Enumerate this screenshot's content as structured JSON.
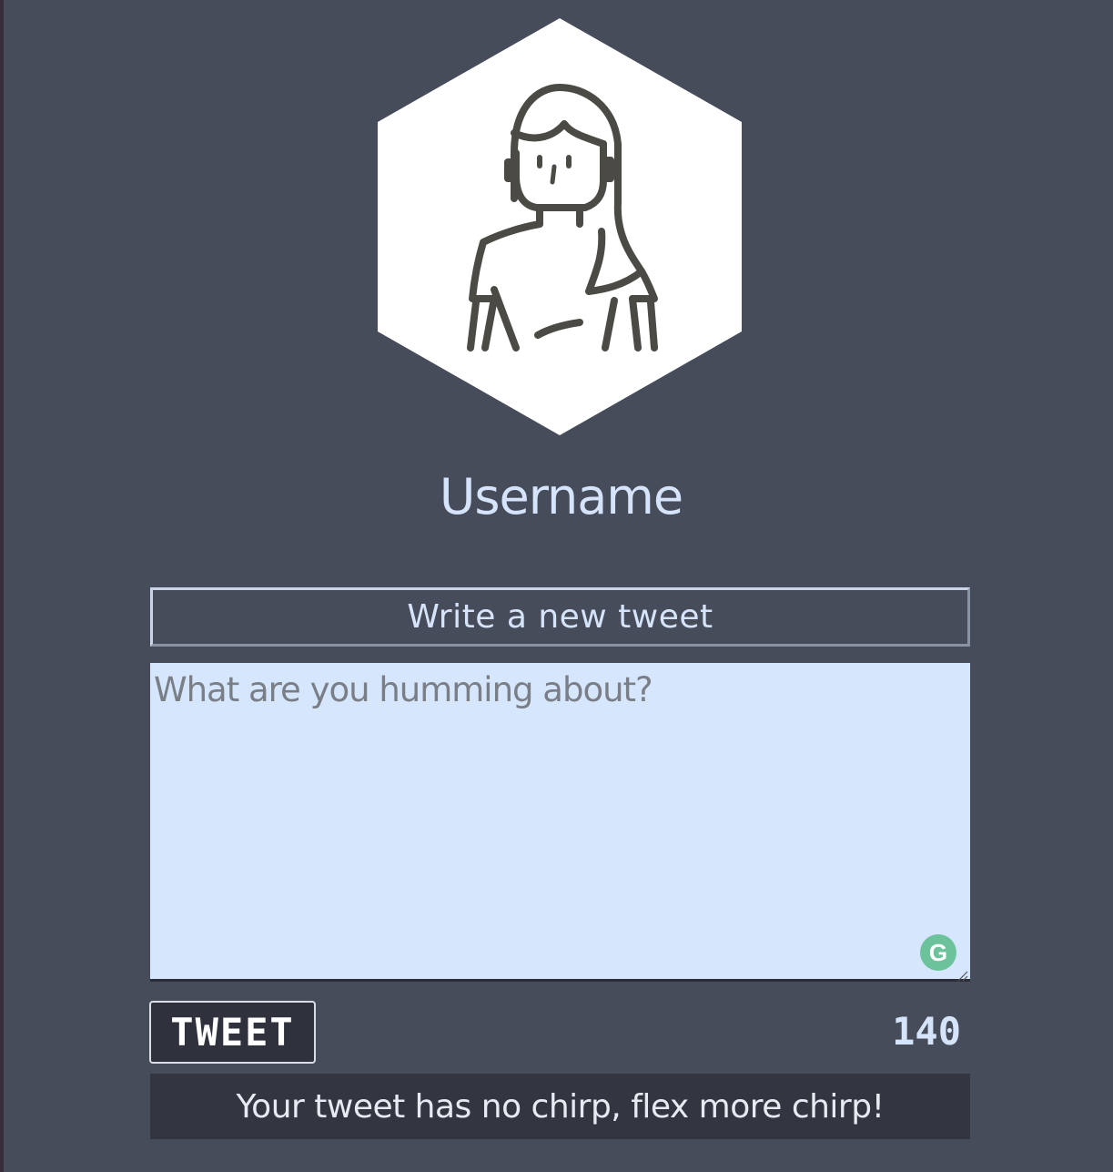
{
  "profile": {
    "avatar_icon": "woman-avatar-icon",
    "username": "Username"
  },
  "composer": {
    "header": "Write a new tweet",
    "placeholder": "What are you humming about?",
    "value": "",
    "grammarly_icon": "grammarly-icon",
    "grammarly_glyph": "G"
  },
  "actions": {
    "tweet_label": "TWEET",
    "char_count": "140"
  },
  "feedback": {
    "message": "Your tweet has no chirp, flex more chirp!"
  },
  "colors": {
    "background": "#474c5a",
    "accent_text": "#d6e4fb",
    "textarea_bg": "#d6e6fc",
    "button_bg": "#2f323d",
    "message_bg": "#333541"
  }
}
